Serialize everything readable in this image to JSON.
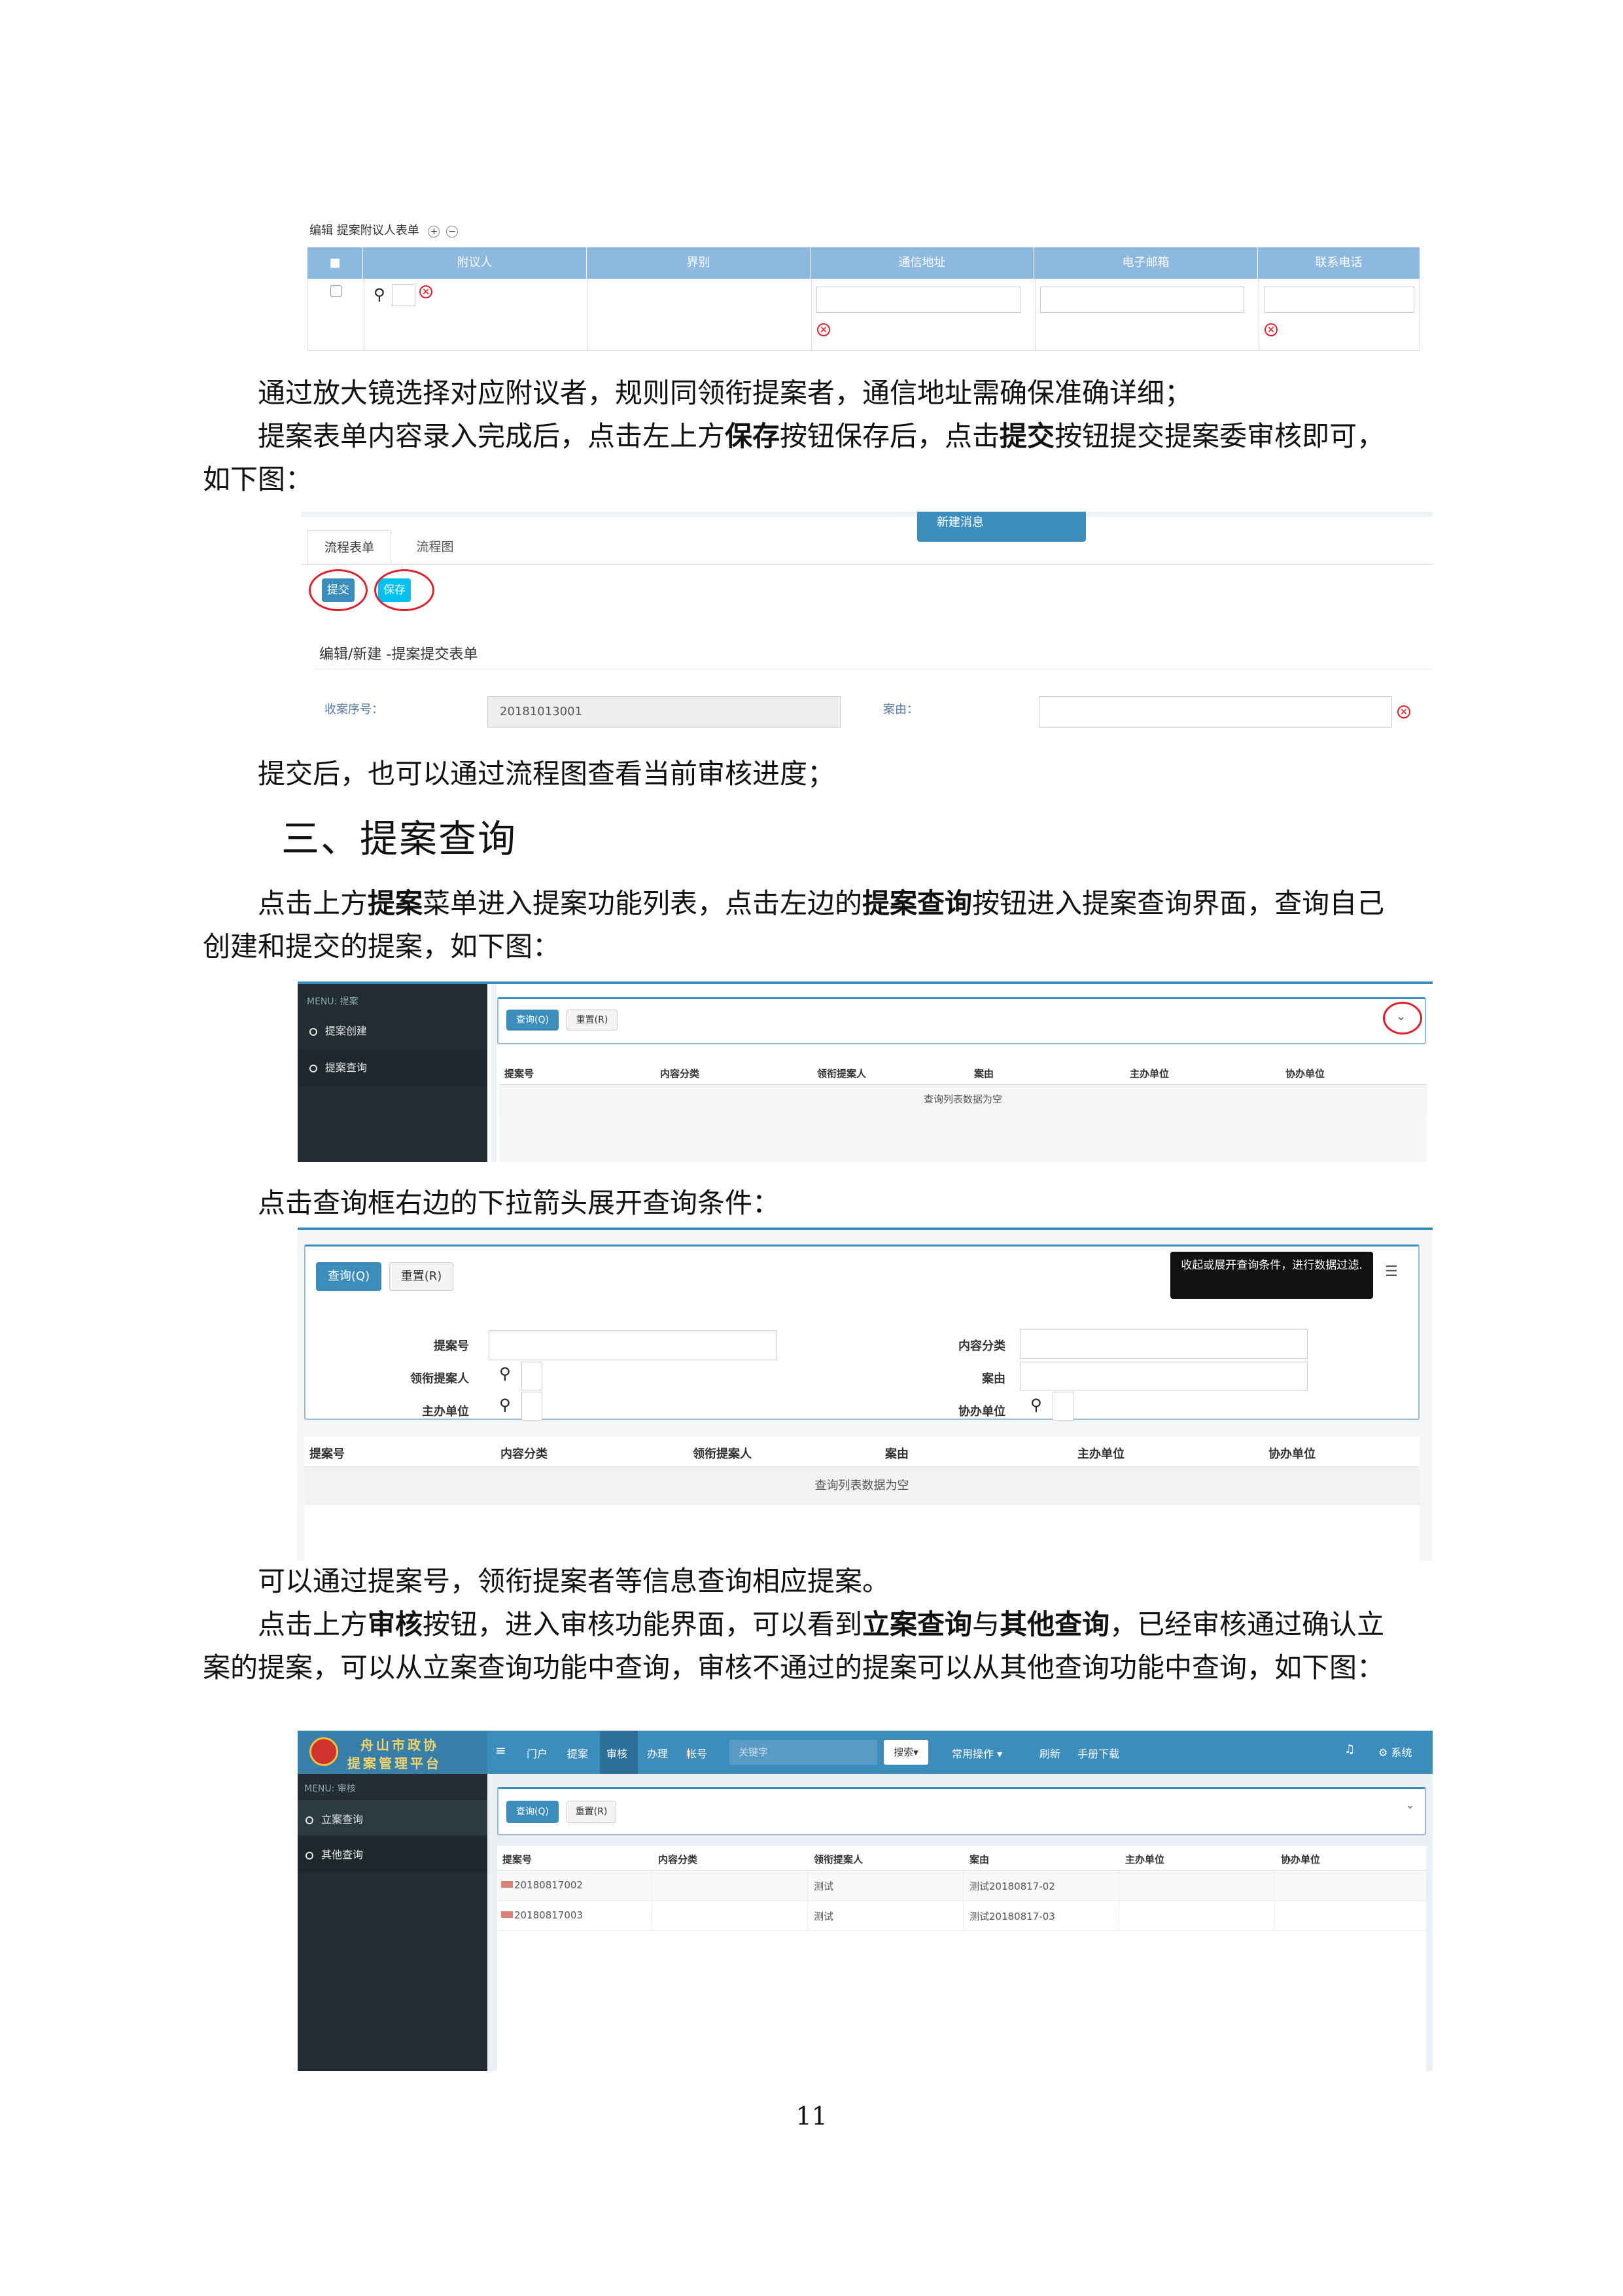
{
  "shot1": {
    "toolbar_label": "编辑  提案附议人表单",
    "plus": "+",
    "minus": "−",
    "headers": [
      "附议人",
      "界别",
      "通信地址",
      "电子邮箱",
      "联系电话"
    ],
    "checkbox_header": "■"
  },
  "para1": "通过放大镜选择对应附议者，规则同领衔提案者，通信地址需确保准确详细；",
  "para2": {
    "pre": "提案表单内容录入完成后，点击左上方",
    "save": "保存",
    "mid": "按钮保存后，点击",
    "submit": "提交",
    "post": "按钮提交提案委审核即可，如下图："
  },
  "shot2": {
    "new_message": "新建消息",
    "tabs": [
      "流程表单",
      "流程图"
    ],
    "submit_btn": "提交",
    "save_btn": "保存",
    "form_title": "编辑/新建 -提案提交表单",
    "receipt_label": "收案序号：",
    "receipt_value": "20181013001",
    "subject_label": "案由："
  },
  "para3": "提交后，也可以通过流程图查看当前审核进度；",
  "heading": "三、提案查询",
  "para4": {
    "pre": "点击上方",
    "menu": "提案",
    "mid": "菜单进入提案功能列表，点击左边的",
    "query": "提案查询",
    "post": "按钮进入提案查询界面，查询自己创建和提交的提案，如下图："
  },
  "shot3": {
    "menu_title": "MENU: 提案",
    "menu_items": [
      "提案创建",
      "提案查询"
    ],
    "query_btn": "查询(Q)",
    "reset_btn": "重置(R)",
    "headers": [
      "提案号",
      "内容分类",
      "领衔提案人",
      "案由",
      "主办单位",
      "协办单位"
    ],
    "empty": "查询列表数据为空"
  },
  "para5": "点击查询框右边的下拉箭头展开查询条件：",
  "shot4": {
    "query_btn": "查询(Q)",
    "reset_btn": "重置(R)",
    "tooltip": "收起或展开查询条件，进行数据过滤.",
    "labels_left": [
      "提案号",
      "领衔提案人",
      "主办单位"
    ],
    "labels_right": [
      "内容分类",
      "案由",
      "协办单位"
    ],
    "headers": [
      "提案号",
      "内容分类",
      "领衔提案人",
      "案由",
      "主办单位",
      "协办单位"
    ],
    "empty": "查询列表数据为空"
  },
  "para6": "可以通过提案号，领衔提案者等信息查询相应提案。",
  "para7": {
    "pre": "点击上方",
    "audit": "审核",
    "mid": "按钮，进入审核功能界面，可以看到",
    "q1": "立案查询",
    "and": "与",
    "q2": "其他查询",
    "post": "，已经审核通过确认立案的提案，可以从立案查询功能中查询，审核不通过的提案可以从其他查询功能中查询，如下图："
  },
  "shot5": {
    "logo_line1": "舟山市政协",
    "logo_line2": "提案管理平台",
    "nav": [
      "门户",
      "提案",
      "审核",
      "办理",
      "帐号"
    ],
    "search_placeholder": "关键字",
    "search_btn": "搜索▾",
    "common_ops": "常用操作 ▾",
    "refresh": "刷新",
    "manual": "手册下载",
    "system": "系统",
    "menu_title": "MENU: 审核",
    "menu_items": [
      "立案查询",
      "其他查询"
    ],
    "query_btn": "查询(Q)",
    "reset_btn": "重置(R)",
    "headers": [
      "提案号",
      "内容分类",
      "领衔提案人",
      "案由",
      "主办单位",
      "协办单位"
    ],
    "rows": [
      {
        "no": "20180817002",
        "category": "",
        "proposer": "测试",
        "subject": "测试20180817-02",
        "host": "",
        "co": ""
      },
      {
        "no": "20180817003",
        "category": "",
        "proposer": "测试",
        "subject": "测试20180817-03",
        "host": "",
        "co": ""
      }
    ],
    "colors": {
      "nav_bg": "#3c8dbc",
      "sidebar_bg": "#222d32",
      "logo_bg": "#367fa9"
    }
  },
  "page_number": "11"
}
